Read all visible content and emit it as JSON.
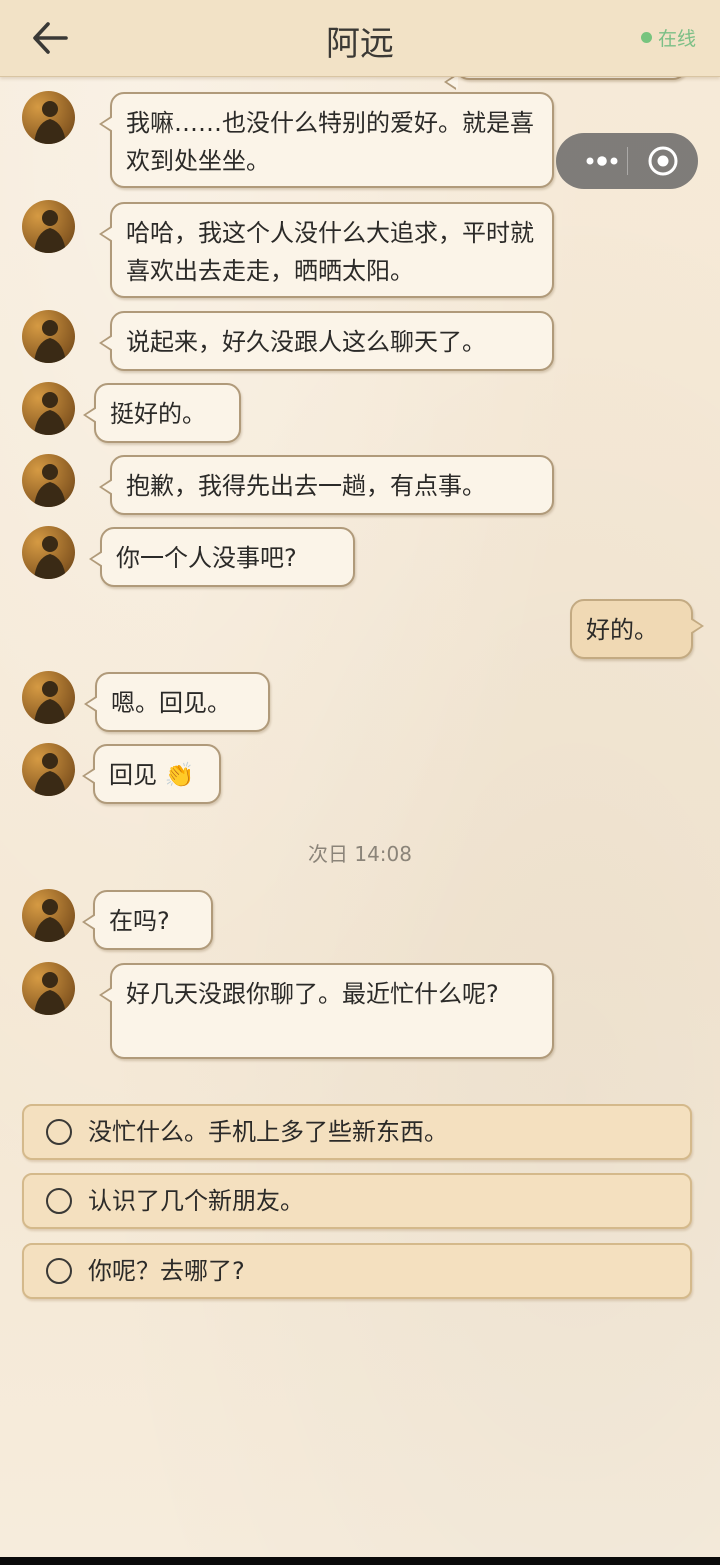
{
  "header": {
    "title": "阿远",
    "status": "在线",
    "status_color": "#77c47e"
  },
  "capsule": {
    "more_icon": "more-dots-icon",
    "close_icon": "target-close-icon"
  },
  "messages": [
    {
      "side": "left",
      "text": "我嘛……也没什么特别的爱好。就是喜欢到处坐坐。"
    },
    {
      "side": "left",
      "text": "哈哈，我这个人没什么大追求，平时就喜欢出去走走，晒晒太阳。"
    },
    {
      "side": "left",
      "text": "说起来，好久没跟人这么聊天了。"
    },
    {
      "side": "left",
      "text": "挺好的。"
    },
    {
      "side": "left",
      "text": "抱歉，我得先出去一趟，有点事。"
    },
    {
      "side": "left",
      "text": "你一个人没事吧?"
    },
    {
      "side": "right",
      "text": "好的。"
    },
    {
      "side": "left",
      "text": "嗯。回见。"
    },
    {
      "side": "left",
      "text": "回见 👏"
    },
    {
      "side": "left",
      "text": "在吗?"
    },
    {
      "side": "left",
      "text": "好几天没跟你聊了。最近忙什么呢?"
    }
  ],
  "timestamp": "次日 14:08",
  "options": [
    {
      "label": "没忙什么。手机上多了些新东西。"
    },
    {
      "label": "认识了几个新朋友。"
    },
    {
      "label": "你呢？去哪了?"
    }
  ]
}
